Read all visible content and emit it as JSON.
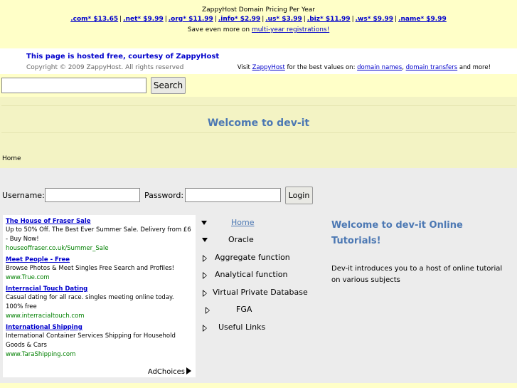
{
  "banner": {
    "title": "ZappyHost Domain Pricing Per Year",
    "prices": [
      ".com* $13.65",
      ".net* $9.99",
      ".org* $11.99",
      ".info* $2.99",
      ".us* $3.99",
      ".biz* $11.99",
      ".ws* $9.99",
      ".name* $9.99"
    ],
    "separator": "|",
    "save_prefix": "Save even more on ",
    "save_link": "multi-year registrations!"
  },
  "host_strip": {
    "hosted_text": "This page is hosted free, courtesy of ZappyHost",
    "copyright": "Copyright © 2009 ZappyHost. All rights reserved",
    "visit_prefix": "Visit ",
    "visit_link": "ZappyHost",
    "visit_middle": " for the best values on: ",
    "link_domain_names": "domain names",
    "comma": ", ",
    "link_domain_transfers": "domain transfers",
    "visit_suffix": " and more!"
  },
  "search": {
    "value": "",
    "button_label": "Search"
  },
  "site": {
    "title": "Welcome to dev-it",
    "breadcrumb": "Home"
  },
  "login": {
    "username_label": "Username:",
    "password_label": "Password:",
    "username_value": "",
    "password_value": "",
    "button_label": "Login"
  },
  "ads": [
    {
      "title": "The House of Fraser Sale",
      "desc": "Up to 50% Off. The Best Ever Summer Sale. Delivery from £6 - Buy Now!",
      "url": "houseoffraser.co.uk/Summer_Sale"
    },
    {
      "title": "Meet People - Free",
      "desc": "Browse Photos & Meet Singles Free Search and Profiles!",
      "url": "www.True.com"
    },
    {
      "title": "Interracial Touch Dating",
      "desc": "Casual dating for all race. singles meeting online today. 100% free",
      "url": "www.interracialtouch.com"
    },
    {
      "title": "International Shipping",
      "desc": "International Container Services Shipping for Household Goods & Cars",
      "url": "www.TaraShipping.com"
    }
  ],
  "adchoices_label": "AdChoices",
  "nav": {
    "items": [
      {
        "label": "Home",
        "link": true
      },
      {
        "label": "Oracle",
        "link": false
      },
      {
        "label": "Aggregate function",
        "link": false
      },
      {
        "label": "Analytical function",
        "link": false
      },
      {
        "label": "Virtual Private Database",
        "link": false
      },
      {
        "label": "FGA",
        "link": false
      },
      {
        "label": "Useful Links",
        "link": false
      }
    ]
  },
  "content": {
    "title": "Welcome to dev-it Online Tutorials!",
    "text": "Dev-it introduces you to a host of online tutorial on various subjects"
  },
  "colors": {
    "page_bg": "#ffffc8",
    "link_blue": "#0000cc",
    "heading_blue": "#4c78b3",
    "ad_url_green": "#008000",
    "main_bg": "#ececec"
  }
}
